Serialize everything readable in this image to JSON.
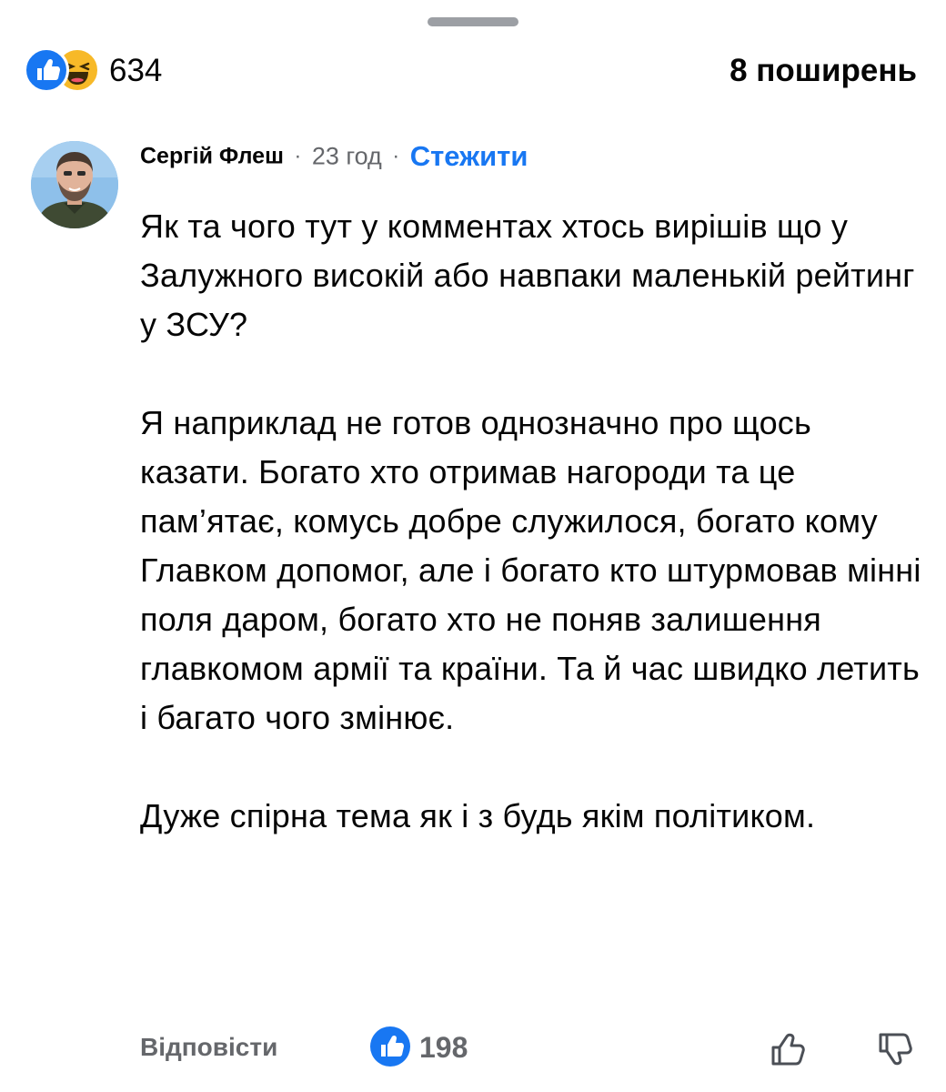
{
  "reactions": {
    "count": "634",
    "types": [
      "like-icon",
      "haha-icon"
    ],
    "shares": "8 поширень"
  },
  "comment": {
    "author": "Сергій Флеш",
    "separator": "·",
    "time": "23 год",
    "follow_label": "Стежити",
    "paragraphs": [
      "Як та чого тут у комментах хтось вирішів що у Залужного високій або навпаки маленькій рейтинг у ЗСУ?",
      "Я наприклад не готов однозначно про щось казати. Богато хто отримав нагороди та це пам’ятає, комусь добре служилося, богато кому Главком допомог, але і богато кто штурмовав мінні поля даром, богато хто не поняв залишення главкомом армії та країни. Та й час швидко летить і багато чого змінює.",
      "Дуже спірна тема як і з будь якім політиком."
    ],
    "reply_label": "Відповісти",
    "like_count": "198"
  },
  "colors": {
    "accent": "#1877f2",
    "secondary_text": "#65676b",
    "haha_yellow": "#f7b928"
  }
}
